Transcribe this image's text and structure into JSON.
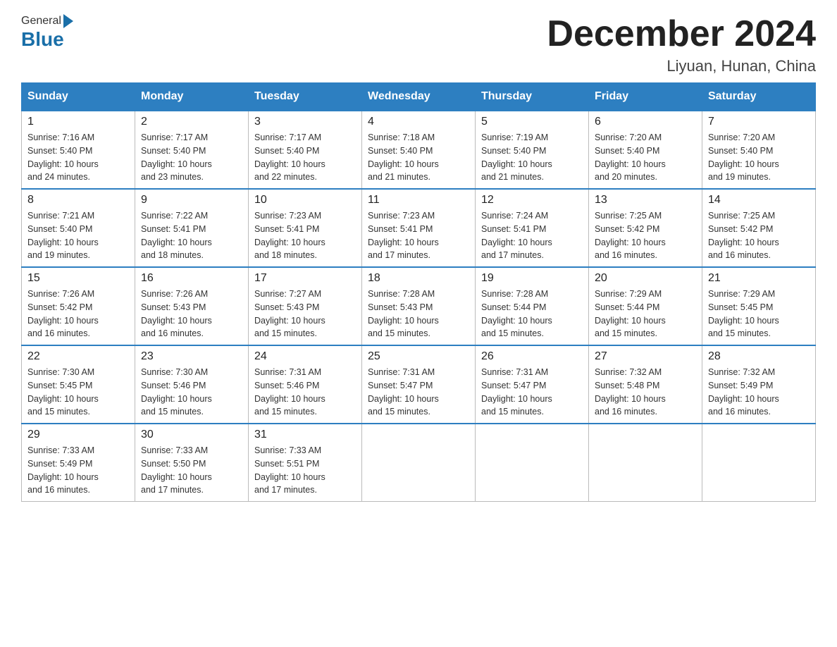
{
  "header": {
    "logo_general": "General",
    "logo_blue": "Blue",
    "title": "December 2024",
    "location": "Liyuan, Hunan, China"
  },
  "days_of_week": [
    "Sunday",
    "Monday",
    "Tuesday",
    "Wednesday",
    "Thursday",
    "Friday",
    "Saturday"
  ],
  "weeks": [
    [
      {
        "day": "1",
        "sunrise": "7:16 AM",
        "sunset": "5:40 PM",
        "daylight": "10 hours and 24 minutes."
      },
      {
        "day": "2",
        "sunrise": "7:17 AM",
        "sunset": "5:40 PM",
        "daylight": "10 hours and 23 minutes."
      },
      {
        "day": "3",
        "sunrise": "7:17 AM",
        "sunset": "5:40 PM",
        "daylight": "10 hours and 22 minutes."
      },
      {
        "day": "4",
        "sunrise": "7:18 AM",
        "sunset": "5:40 PM",
        "daylight": "10 hours and 21 minutes."
      },
      {
        "day": "5",
        "sunrise": "7:19 AM",
        "sunset": "5:40 PM",
        "daylight": "10 hours and 21 minutes."
      },
      {
        "day": "6",
        "sunrise": "7:20 AM",
        "sunset": "5:40 PM",
        "daylight": "10 hours and 20 minutes."
      },
      {
        "day": "7",
        "sunrise": "7:20 AM",
        "sunset": "5:40 PM",
        "daylight": "10 hours and 19 minutes."
      }
    ],
    [
      {
        "day": "8",
        "sunrise": "7:21 AM",
        "sunset": "5:40 PM",
        "daylight": "10 hours and 19 minutes."
      },
      {
        "day": "9",
        "sunrise": "7:22 AM",
        "sunset": "5:41 PM",
        "daylight": "10 hours and 18 minutes."
      },
      {
        "day": "10",
        "sunrise": "7:23 AM",
        "sunset": "5:41 PM",
        "daylight": "10 hours and 18 minutes."
      },
      {
        "day": "11",
        "sunrise": "7:23 AM",
        "sunset": "5:41 PM",
        "daylight": "10 hours and 17 minutes."
      },
      {
        "day": "12",
        "sunrise": "7:24 AM",
        "sunset": "5:41 PM",
        "daylight": "10 hours and 17 minutes."
      },
      {
        "day": "13",
        "sunrise": "7:25 AM",
        "sunset": "5:42 PM",
        "daylight": "10 hours and 16 minutes."
      },
      {
        "day": "14",
        "sunrise": "7:25 AM",
        "sunset": "5:42 PM",
        "daylight": "10 hours and 16 minutes."
      }
    ],
    [
      {
        "day": "15",
        "sunrise": "7:26 AM",
        "sunset": "5:42 PM",
        "daylight": "10 hours and 16 minutes."
      },
      {
        "day": "16",
        "sunrise": "7:26 AM",
        "sunset": "5:43 PM",
        "daylight": "10 hours and 16 minutes."
      },
      {
        "day": "17",
        "sunrise": "7:27 AM",
        "sunset": "5:43 PM",
        "daylight": "10 hours and 15 minutes."
      },
      {
        "day": "18",
        "sunrise": "7:28 AM",
        "sunset": "5:43 PM",
        "daylight": "10 hours and 15 minutes."
      },
      {
        "day": "19",
        "sunrise": "7:28 AM",
        "sunset": "5:44 PM",
        "daylight": "10 hours and 15 minutes."
      },
      {
        "day": "20",
        "sunrise": "7:29 AM",
        "sunset": "5:44 PM",
        "daylight": "10 hours and 15 minutes."
      },
      {
        "day": "21",
        "sunrise": "7:29 AM",
        "sunset": "5:45 PM",
        "daylight": "10 hours and 15 minutes."
      }
    ],
    [
      {
        "day": "22",
        "sunrise": "7:30 AM",
        "sunset": "5:45 PM",
        "daylight": "10 hours and 15 minutes."
      },
      {
        "day": "23",
        "sunrise": "7:30 AM",
        "sunset": "5:46 PM",
        "daylight": "10 hours and 15 minutes."
      },
      {
        "day": "24",
        "sunrise": "7:31 AM",
        "sunset": "5:46 PM",
        "daylight": "10 hours and 15 minutes."
      },
      {
        "day": "25",
        "sunrise": "7:31 AM",
        "sunset": "5:47 PM",
        "daylight": "10 hours and 15 minutes."
      },
      {
        "day": "26",
        "sunrise": "7:31 AM",
        "sunset": "5:47 PM",
        "daylight": "10 hours and 15 minutes."
      },
      {
        "day": "27",
        "sunrise": "7:32 AM",
        "sunset": "5:48 PM",
        "daylight": "10 hours and 16 minutes."
      },
      {
        "day": "28",
        "sunrise": "7:32 AM",
        "sunset": "5:49 PM",
        "daylight": "10 hours and 16 minutes."
      }
    ],
    [
      {
        "day": "29",
        "sunrise": "7:33 AM",
        "sunset": "5:49 PM",
        "daylight": "10 hours and 16 minutes."
      },
      {
        "day": "30",
        "sunrise": "7:33 AM",
        "sunset": "5:50 PM",
        "daylight": "10 hours and 17 minutes."
      },
      {
        "day": "31",
        "sunrise": "7:33 AM",
        "sunset": "5:51 PM",
        "daylight": "10 hours and 17 minutes."
      },
      null,
      null,
      null,
      null
    ]
  ],
  "labels": {
    "sunrise": "Sunrise:",
    "sunset": "Sunset:",
    "daylight": "Daylight:"
  }
}
